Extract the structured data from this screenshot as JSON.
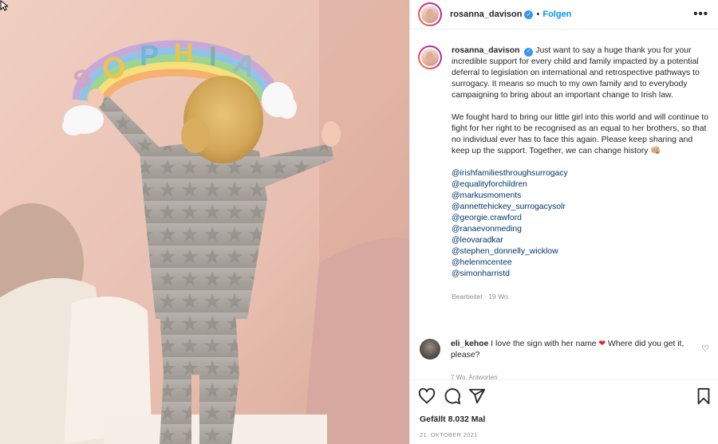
{
  "post": {
    "username": "rosanna_davison",
    "verified_mark": "✓",
    "separator": "•",
    "follow_label": "Folgen",
    "more_label": "•••",
    "caption_paragraph_1": "Just want to say a huge thank you for your incredible support for every child and family impacted by a potential deferral to legislation on international and retrospective pathways to surrogacy. It means so much to my own family and to everybody campaigning to bring about an important change to Irish law.",
    "caption_paragraph_2": "We fought hard to bring our little girl into this world and will continue to fight for her right to be recognised as an equal to her brothers, so that no individual ever has to face this again. Please keep sharing and keep up the support. Together, we can change history",
    "caption_emoji": "👊🏼",
    "tags": [
      "@irishfamiliesthroughsurrogacy",
      "@equalityforchildren",
      "@markusmoments",
      "@annettehickey_surrogacysolr",
      "@georgie.crawford",
      "@ranaevonmeding",
      "@leovaradkar",
      "@stephen_donnelly_wicklow",
      "@helenmcentee",
      "@simonharristd"
    ],
    "edited_label": "Bearbeitet · 19 Wo.",
    "photo_sign_letters": [
      "S",
      "O",
      "P",
      "H",
      "I",
      "A"
    ]
  },
  "comment": {
    "username": "eli_kehoe",
    "text_before": "I love the sign with her name",
    "heart": "❤",
    "text_after": "Where did you get it, please?",
    "like_icon": "♡",
    "meta": "7 Wo.    Antworten"
  },
  "actions": {
    "icons": [
      "heart-icon",
      "comment-icon",
      "share-icon",
      "bookmark-icon"
    ],
    "likes_label": "Gefällt 8.032 Mal",
    "date_label": "21. OKTOBER 2021"
  },
  "colors": {
    "link": "#00376b",
    "follow": "#0095f6",
    "verified": "#3897f0",
    "muted": "#8e8e8e"
  }
}
